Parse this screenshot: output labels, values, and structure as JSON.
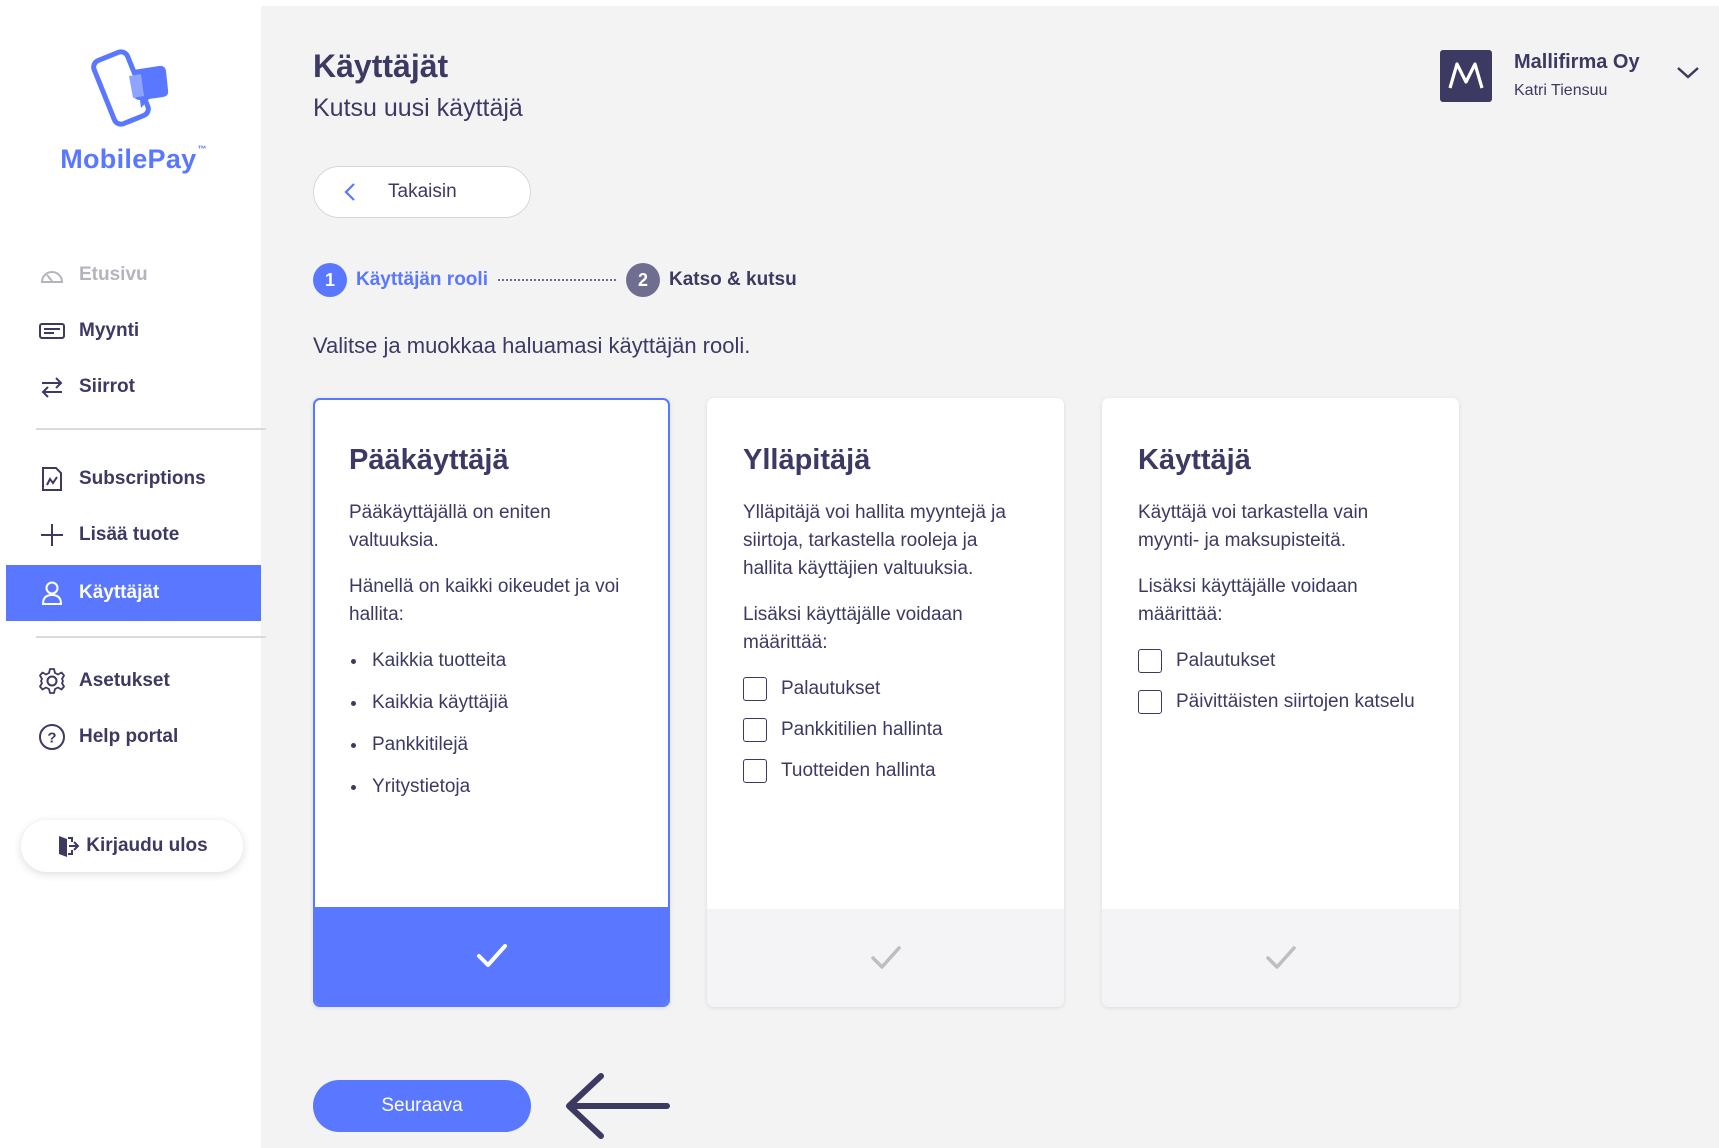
{
  "brand": {
    "name": "MobilePay",
    "trademark": "™",
    "accent_color": "#5a78ff",
    "text_color": "#3c3a63"
  },
  "sidebar": {
    "items": [
      {
        "label": "Etusivu",
        "icon": "speedometer-icon",
        "state": "disabled"
      },
      {
        "label": "Myynti",
        "icon": "card-icon",
        "state": "normal"
      },
      {
        "label": "Siirrot",
        "icon": "transfer-arrows-icon",
        "state": "normal"
      },
      {
        "label": "Subscriptions",
        "icon": "document-edit-icon",
        "state": "normal"
      },
      {
        "label": "Lisää tuote",
        "icon": "plus-icon",
        "state": "normal"
      },
      {
        "label": "Käyttäjät",
        "icon": "user-icon",
        "state": "active"
      },
      {
        "label": "Asetukset",
        "icon": "gear-icon",
        "state": "normal"
      },
      {
        "label": "Help portal",
        "icon": "question-circle-icon",
        "state": "normal"
      }
    ],
    "logout_label": "Kirjaudu ulos"
  },
  "header": {
    "title": "Käyttäjät",
    "subtitle": "Kutsu uusi käyttäjä",
    "back_label": "Takaisin"
  },
  "account": {
    "org_name": "Mallifirma Oy",
    "user_name": "Katri Tiensuu",
    "logo_letter": "M"
  },
  "stepper": {
    "steps": [
      {
        "number": "1",
        "label": "Käyttäjän rooli",
        "active": true
      },
      {
        "number": "2",
        "label": "Katso & kutsu",
        "active": false
      }
    ]
  },
  "instruction": "Valitse ja muokkaa haluamasi käyttäjän rooli.",
  "roles": [
    {
      "title": "Pääkäyttäjä",
      "selected": true,
      "description": "Pääkäyttäjällä on eniten valtuuksia.",
      "extra_text": "Hänellä on kaikki oikeudet ja voi hallita:",
      "bullets": [
        "Kaikkia tuotteita",
        "Kaikkia käyttäjiä",
        "Pankkitilejä",
        "Yritystietoja"
      ]
    },
    {
      "title": "Ylläpitäjä",
      "selected": false,
      "description": "Ylläpitäjä voi hallita myyntejä ja siirtoja, tarkastella rooleja ja hallita käyttäjien valtuuksia.",
      "extra_text": "Lisäksi käyttäjälle voidaan määrittää:",
      "options": [
        {
          "label": "Palautukset",
          "checked": false
        },
        {
          "label": "Pankkitilien hallinta",
          "checked": false
        },
        {
          "label": "Tuotteiden hallinta",
          "checked": false
        }
      ]
    },
    {
      "title": "Käyttäjä",
      "selected": false,
      "description": "Käyttäjä voi tarkastella vain myynti- ja maksupisteitä.",
      "extra_text": "Lisäksi käyttäjälle voidaan määrittää:",
      "options": [
        {
          "label": "Palautukset",
          "checked": false
        },
        {
          "label": "Päivittäisten siirtojen katselu",
          "checked": false
        }
      ]
    }
  ],
  "footer": {
    "next_label": "Seuraava"
  }
}
